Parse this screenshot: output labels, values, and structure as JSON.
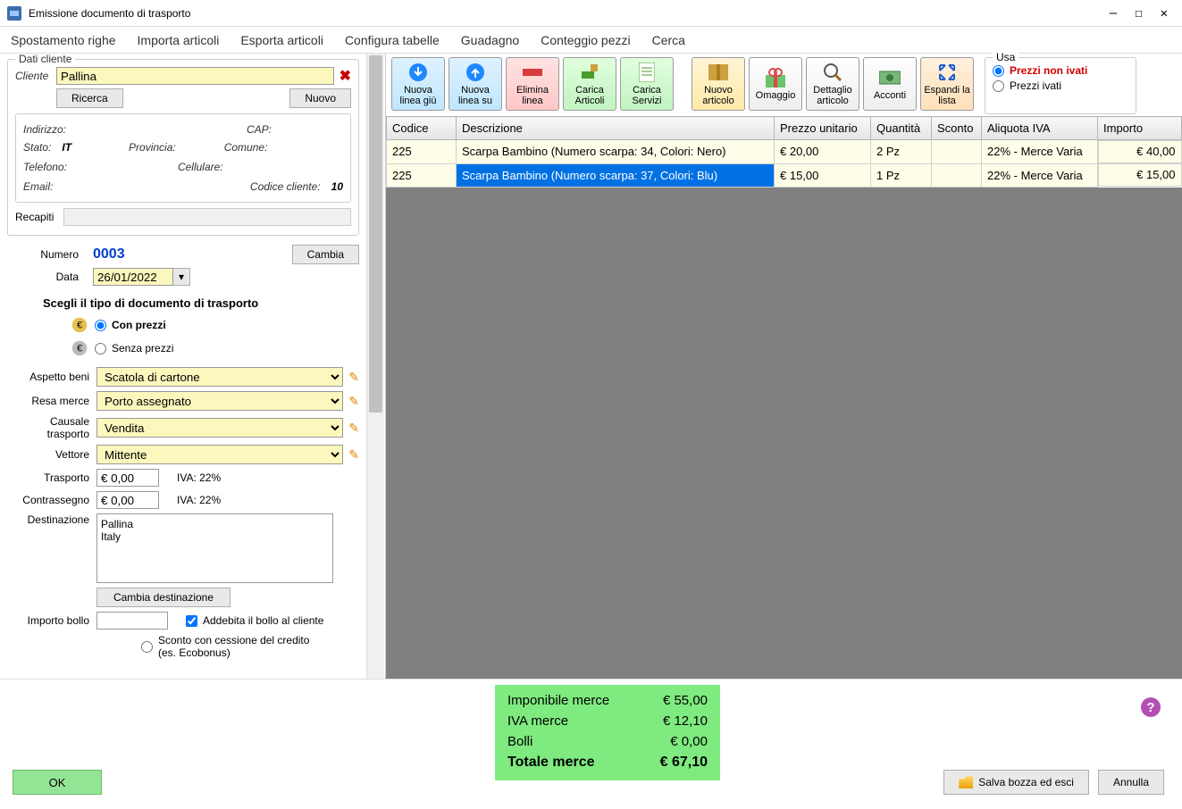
{
  "window": {
    "title": "Emissione documento di trasporto"
  },
  "menu": [
    "Spostamento righe",
    "Importa articoli",
    "Esporta articoli",
    "Configura tabelle",
    "Guadagno",
    "Conteggio pezzi",
    "Cerca"
  ],
  "client_box": {
    "legend": "Dati cliente",
    "cliente_lbl": "Cliente",
    "cliente_val": "Pallina",
    "ricerca_btn": "Ricerca",
    "nuovo_btn": "Nuovo",
    "indirizzo_lbl": "Indirizzo:",
    "cap_lbl": "CAP:",
    "stato_lbl": "Stato:",
    "stato_val": "IT",
    "provincia_lbl": "Provincia:",
    "comune_lbl": "Comune:",
    "telefono_lbl": "Telefono:",
    "cellulare_lbl": "Cellulare:",
    "email_lbl": "Email:",
    "codice_cliente_lbl": "Codice cliente:",
    "codice_cliente_val": "10",
    "recapiti_lbl": "Recapiti"
  },
  "doc": {
    "numero_lbl": "Numero",
    "numero_val": "0003",
    "cambia_btn": "Cambia",
    "data_lbl": "Data",
    "data_val": "26/01/2022",
    "scegli_lbl": "Scegli il tipo di documento di trasporto",
    "con_prezzi": "Con prezzi",
    "senza_prezzi": "Senza prezzi"
  },
  "form": {
    "aspetto_lbl": "Aspetto beni",
    "aspetto_val": "Scatola di cartone",
    "resa_lbl": "Resa merce",
    "resa_val": "Porto assegnato",
    "causale_lbl": "Causale trasporto",
    "causale_val": "Vendita",
    "vettore_lbl": "Vettore",
    "vettore_val": "Mittente",
    "trasporto_lbl": "Trasporto",
    "trasporto_val": "€ 0,00",
    "iva22": "IVA: 22%",
    "contrassegno_lbl": "Contrassegno",
    "contrassegno_val": "€ 0,00",
    "destinazione_lbl": "Destinazione",
    "destinazione_val": "Pallina\nItaly",
    "cambia_dest_btn": "Cambia destinazione",
    "importo_bollo_lbl": "Importo bollo",
    "addebita_bollo_lbl": "Addebita il bollo al cliente",
    "sconto_cessione_lbl": "Sconto con cessione del credito (es. Ecobonus)"
  },
  "toolbar": {
    "nuova_giu": "Nuova linea giù",
    "nuova_su": "Nuova linea su",
    "elimina": "Elimina linea",
    "carica_art": "Carica Articoli",
    "carica_serv": "Carica Servizi",
    "nuovo_art": "Nuovo articolo",
    "omaggio": "Omaggio",
    "dettaglio": "Dettaglio articolo",
    "acconti": "Acconti",
    "espandi": "Espandi la lista"
  },
  "usa": {
    "legend": "Usa",
    "non_ivati": "Prezzi non ivati",
    "ivati": "Prezzi ivati"
  },
  "grid": {
    "headers": [
      "Codice",
      "Descrizione",
      "Prezzo unitario",
      "Quantità",
      "Sconto",
      "Aliquota IVA",
      "Importo"
    ],
    "rows": [
      {
        "codice": "225",
        "descrizione": "Scarpa Bambino (Numero scarpa: 34, Colori: Nero)",
        "prezzo": "€ 20,00",
        "qty": "2 Pz",
        "sconto": "",
        "iva": "22% - Merce Varia",
        "importo": "€ 40,00",
        "selected": false
      },
      {
        "codice": "225",
        "descrizione": "Scarpa Bambino (Numero scarpa: 37, Colori: Blu)",
        "prezzo": "€ 15,00",
        "qty": "1 Pz",
        "sconto": "",
        "iva": "22% - Merce Varia",
        "importo": "€ 15,00",
        "selected": true
      }
    ]
  },
  "totals": {
    "imponibile_lbl": "Imponibile merce",
    "imponibile_val": "€ 55,00",
    "iva_lbl": "IVA merce",
    "iva_val": "€ 12,10",
    "bolli_lbl": "Bolli",
    "bolli_val": "€ 0,00",
    "totale_lbl": "Totale merce",
    "totale_val": "€ 67,10"
  },
  "footer": {
    "ok": "OK",
    "salva_bozza": "Salva bozza ed esci",
    "annulla": "Annulla"
  }
}
